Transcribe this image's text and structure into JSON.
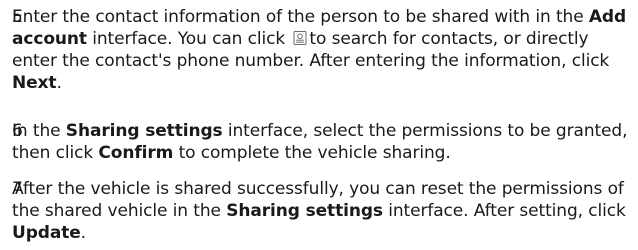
{
  "steps": [
    {
      "number": "5",
      "segments": [
        "Enter the contact information of the person to be shared with in the ",
        "Add account",
        " interface. You can click ",
        "to search for contacts, or directly enter the contact's phone number. After entering the information, click ",
        "Next",
        "."
      ],
      "icon": "contact-book-icon"
    },
    {
      "number": "6",
      "segments": [
        "In the ",
        "Sharing settings",
        " interface, select the permissions to be granted, then click ",
        "Confirm",
        " to complete the vehicle sharing."
      ]
    },
    {
      "number": "7",
      "segments": [
        "After the vehicle is shared successfully, you can reset the permissions of the shared vehicle in the ",
        "Sharing settings",
        " interface. After setting, click ",
        "Update",
        "."
      ]
    }
  ],
  "colors": {
    "text": "#1a1a1a",
    "icon_stroke": "#6b6b6b"
  }
}
